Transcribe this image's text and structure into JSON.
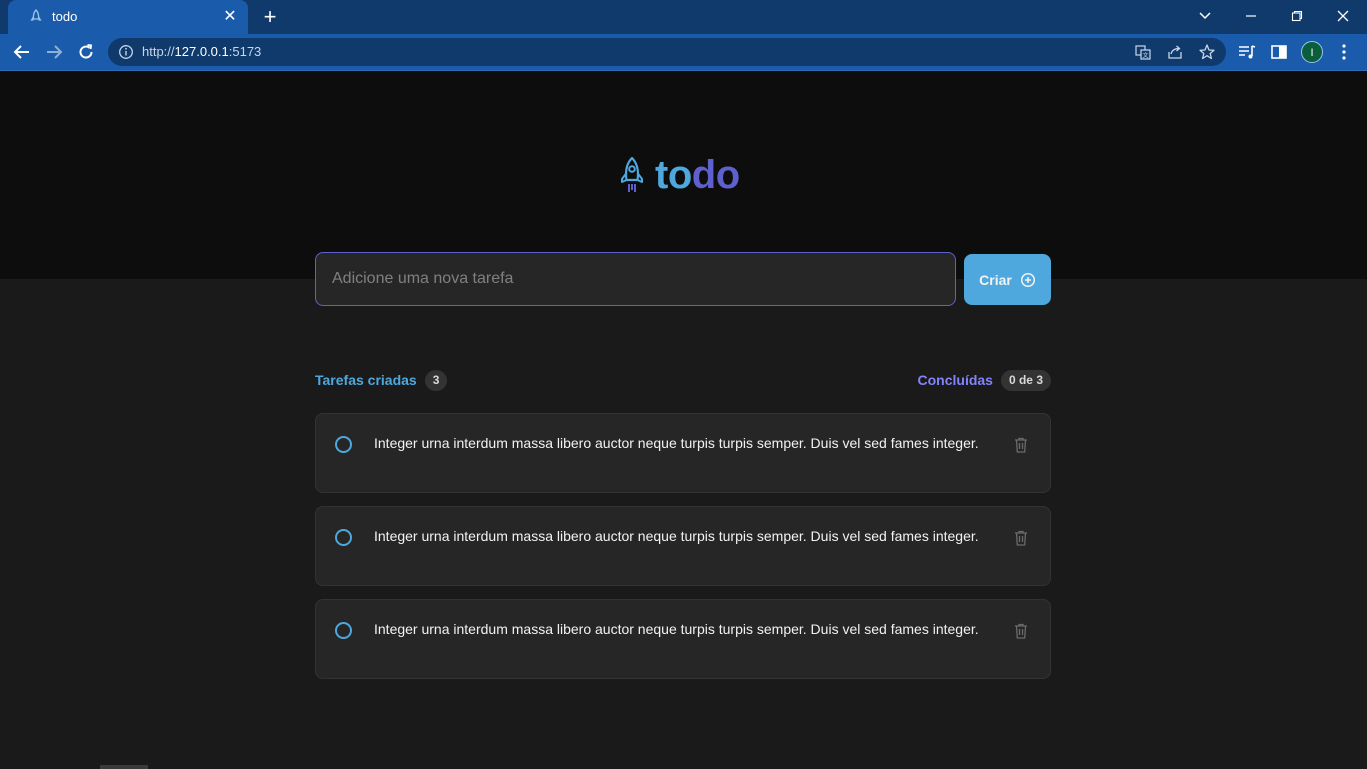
{
  "browser": {
    "tab_title": "todo",
    "tab_close": "✕",
    "new_tab": "+",
    "url_prefix": "http://",
    "url_host": "127.0.0.1",
    "url_port": ":5173",
    "profile_initial": "I"
  },
  "app": {
    "logo_part1": "to",
    "logo_part2": "do",
    "input_placeholder": "Adicione uma nova tarefa",
    "create_label": "Criar",
    "created_label": "Tarefas criadas",
    "created_count": "3",
    "done_label": "Concluídas",
    "done_count": "0 de 3",
    "tasks": [
      {
        "text": "Integer urna interdum massa libero auctor neque turpis turpis semper. Duis vel sed fames integer.",
        "done": false
      },
      {
        "text": "Integer urna interdum massa libero auctor neque turpis turpis semper. Duis vel sed fames integer.",
        "done": false
      },
      {
        "text": "Integer urna interdum massa libero auctor neque turpis turpis semper. Duis vel sed fames integer.",
        "done": false
      }
    ]
  },
  "colors": {
    "blue": "#4ea8de",
    "purple": "#5e60ce",
    "header_bg": "#0d0d0d",
    "body_bg": "#1a1a1a",
    "card_bg": "#262626"
  }
}
